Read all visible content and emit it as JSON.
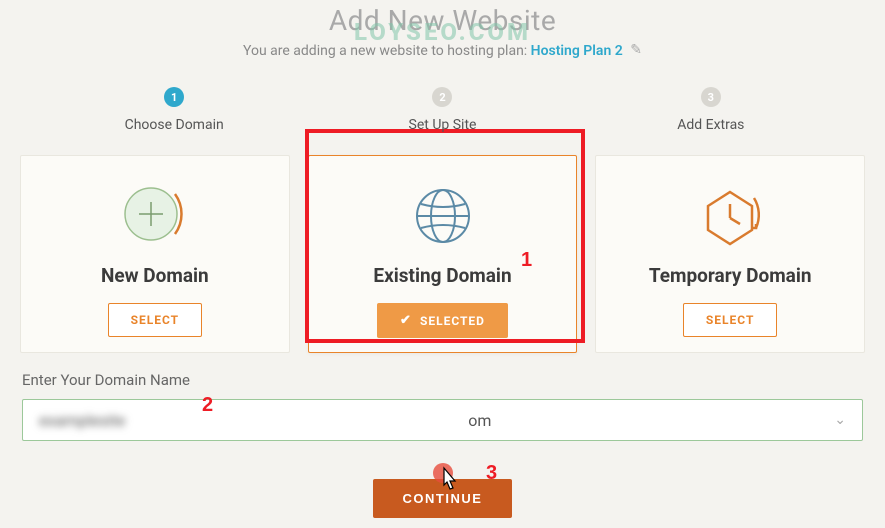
{
  "header": {
    "title": "Add New Website",
    "subtitle_prefix": "You are adding a new website to hosting plan: ",
    "plan_name": "Hosting Plan 2",
    "watermark": "LOYSEO.COM"
  },
  "steps": [
    {
      "num": "1",
      "label": "Choose Domain",
      "active": true
    },
    {
      "num": "2",
      "label": "Set Up Site",
      "active": false
    },
    {
      "num": "3",
      "label": "Add Extras",
      "active": false
    }
  ],
  "cards": {
    "new": {
      "title": "New Domain",
      "button": "SELECT"
    },
    "existing": {
      "title": "Existing Domain",
      "button": "SELECTED"
    },
    "temporary": {
      "title": "Temporary Domain",
      "button": "SELECT"
    }
  },
  "domain": {
    "label": "Enter Your Domain Name",
    "value_blurred": "examplesite",
    "value_suffix": "om"
  },
  "continue": {
    "label": "CONTINUE"
  },
  "annotations": {
    "a1": "1",
    "a2": "2",
    "a3": "3"
  }
}
